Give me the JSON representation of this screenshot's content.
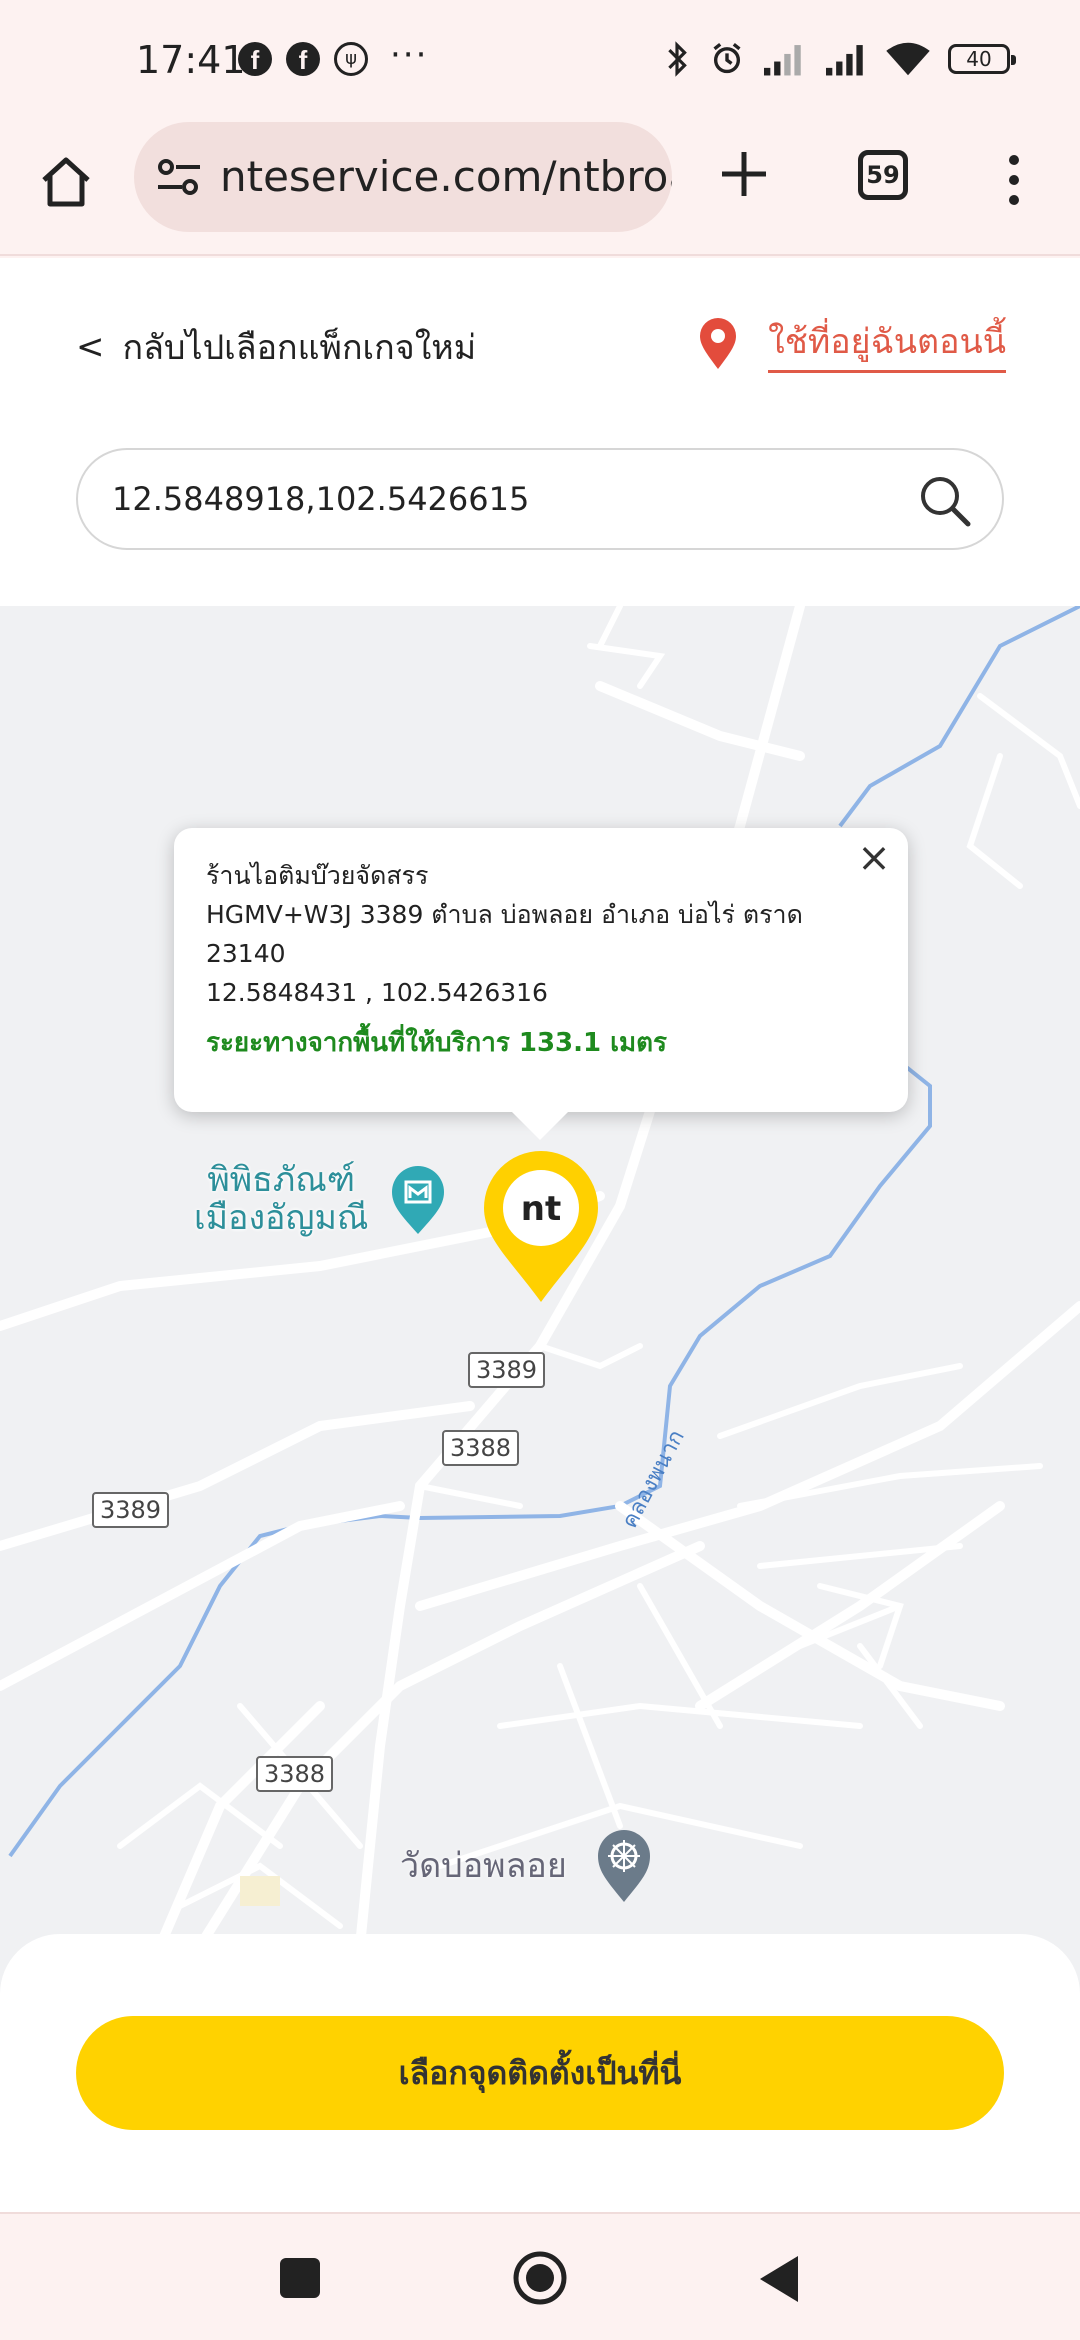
{
  "status_bar": {
    "time": "17:41",
    "more": "···",
    "battery": "40"
  },
  "browser": {
    "url": "nteservice.com/ntbroa",
    "tab_count": "59"
  },
  "header": {
    "back_label": "กลับไปเลือกแพ็กเกจใหม่",
    "back_chevron": "<",
    "current_location_label": "ใช้ที่อยู่ฉันตอนนี้"
  },
  "search": {
    "value": "12.5848918,102.5426615"
  },
  "map": {
    "poi_museum": "พิพิธภัณฑ์\nเมืองอัญมณี",
    "poi_temple": "วัดบ่อพลอย",
    "river_label": "คลองพนาก",
    "road_shields": [
      "3389",
      "3388",
      "3389",
      "3388"
    ],
    "marker_label": "nt"
  },
  "popup": {
    "name": "ร้านไอติมบ๊วยจัดสรร",
    "address": "HGMV+W3J 3389 ตำบล บ่อพลอย อำเภอ บ่อไร่ ตราด",
    "postcode": "23140",
    "coordinates": "12.5848431 , 102.5426316",
    "distance": "ระยะทางจากพื้นที่ให้บริการ 133.1 เมตร",
    "close": "×"
  },
  "bottom": {
    "confirm_label": "เลือกจุดติดตั้งเป็นที่นี่"
  },
  "colors": {
    "accent": "#ffd200",
    "link": "#e05a47",
    "distance": "#1e8a1e",
    "poi": "#2d8f9a"
  }
}
